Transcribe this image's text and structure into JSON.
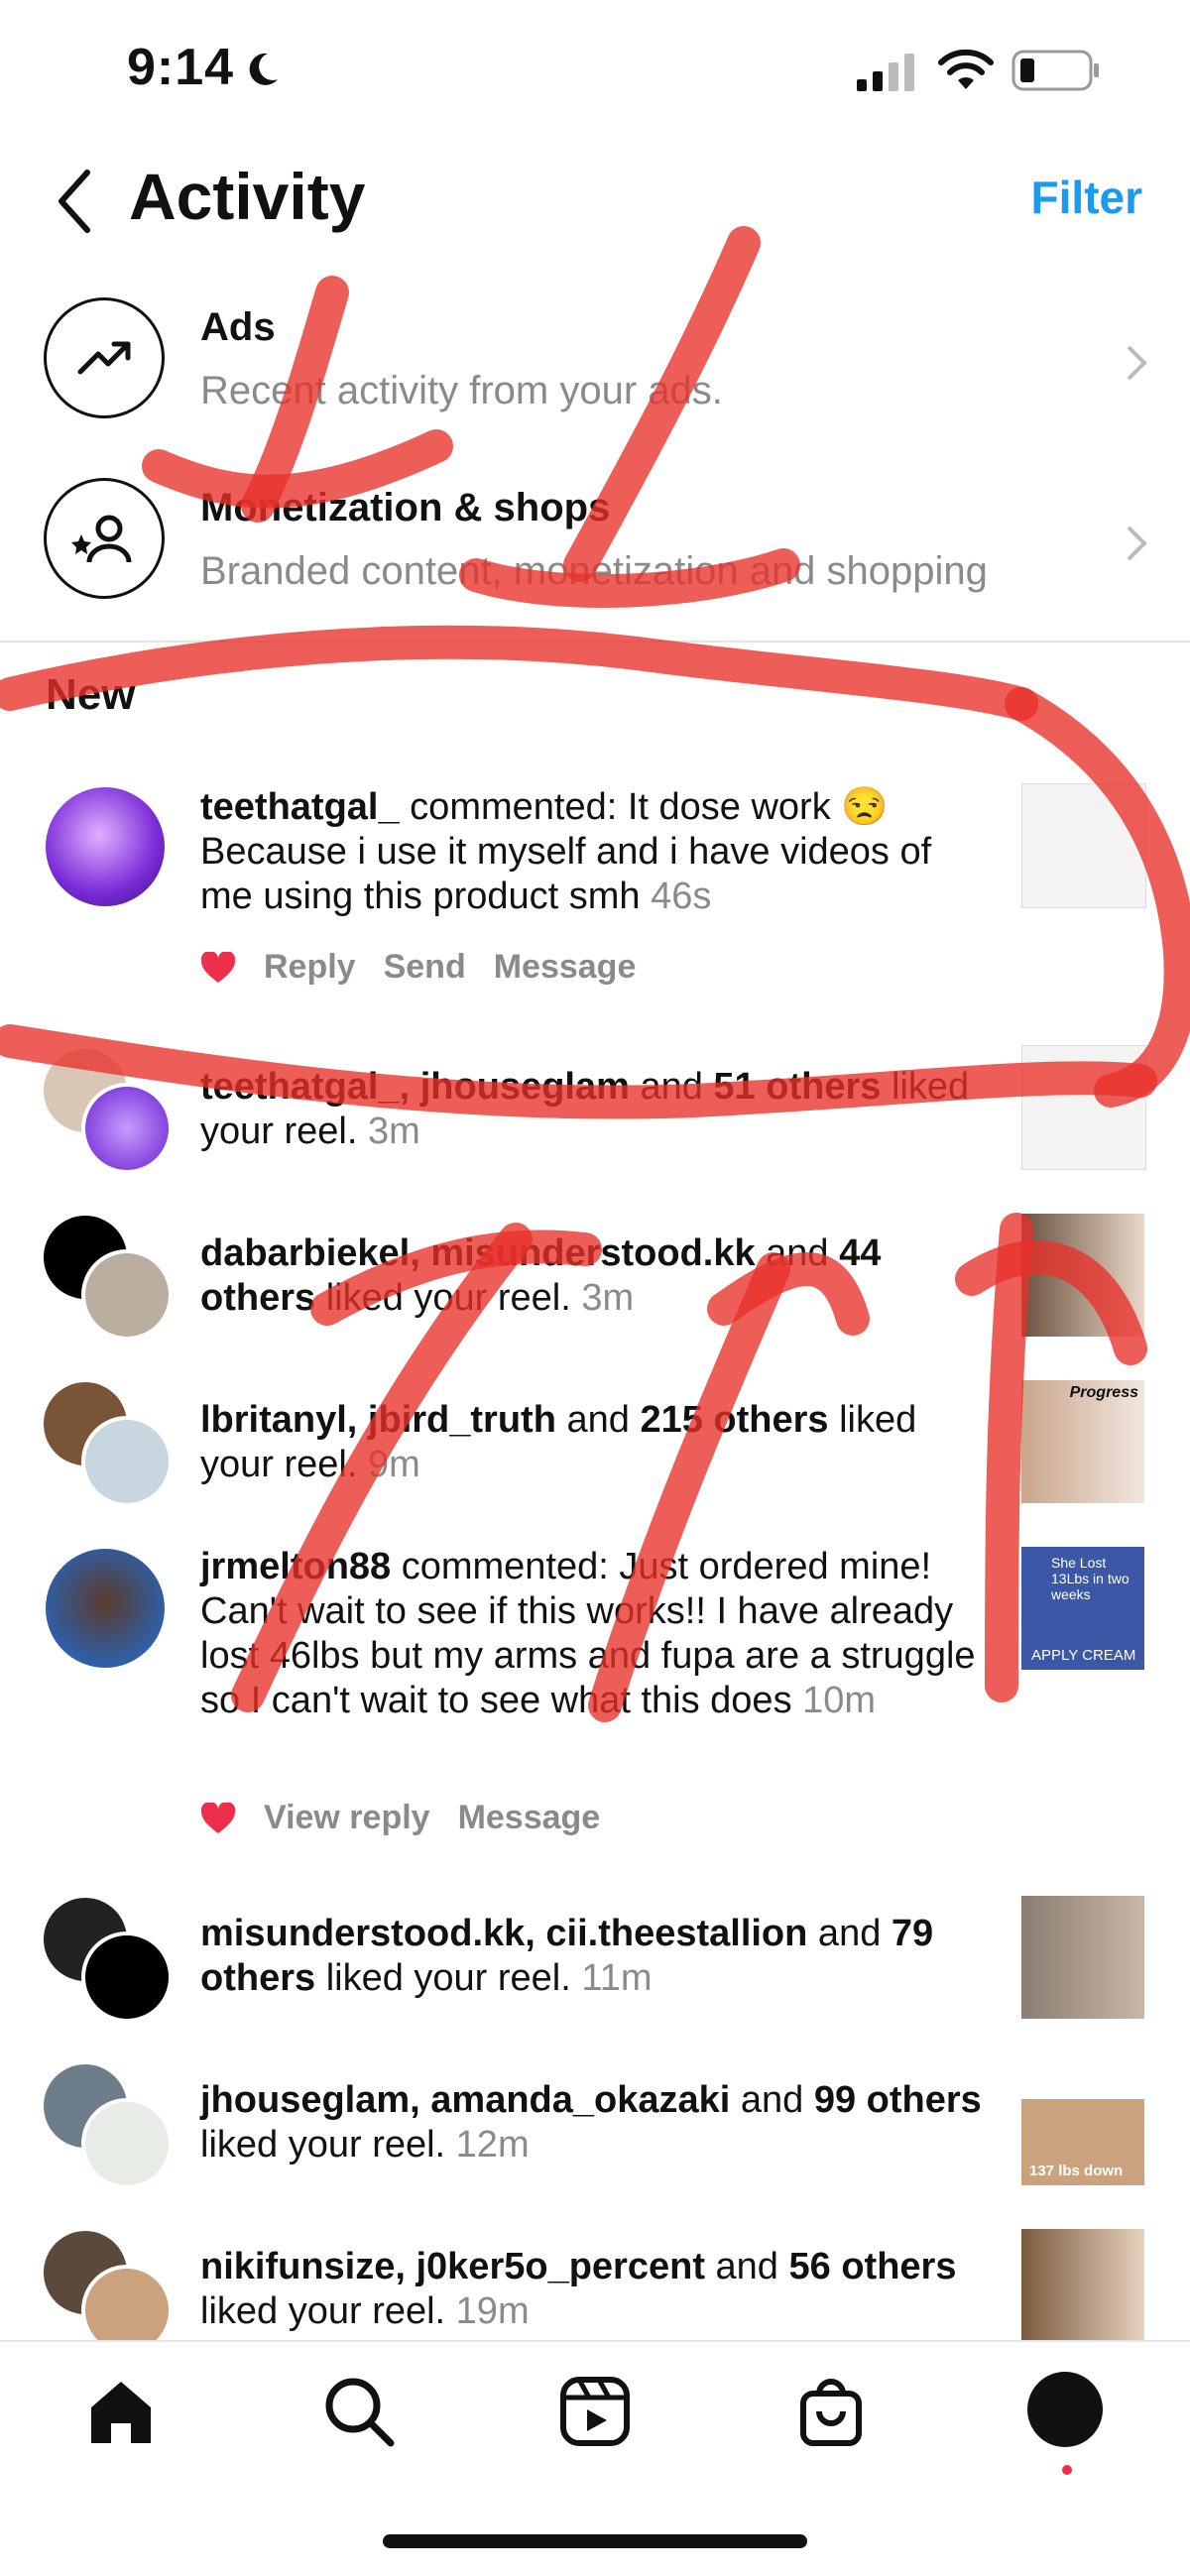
{
  "status": {
    "time": "9:14"
  },
  "header": {
    "title": "Activity",
    "filter_label": "Filter"
  },
  "menu": [
    {
      "title": "Ads",
      "subtitle": "Recent activity from your ads."
    },
    {
      "title": "Monetization & shops",
      "subtitle": "Branded content, monetization and shopping"
    }
  ],
  "section": {
    "new_label": "New"
  },
  "notifications": [
    {
      "user": "teethatgal_",
      "text": " commented: It dose work 😒 Because i use it myself and i have videos of me using this product smh ",
      "time": "46s",
      "actions": [
        "Reply",
        "Send",
        "Message"
      ]
    },
    {
      "users": "teethatgal_, jhouseglam",
      "mid": " and ",
      "others": "51 others",
      "text": " liked your reel. ",
      "time": "3m"
    },
    {
      "users": "dabarbiekel, misunderstood.kk",
      "mid": " and ",
      "others": "44 others",
      "text": " liked your reel. ",
      "time": "3m"
    },
    {
      "users": "lbritanyl, jbird_truth",
      "mid": " and ",
      "others": "215 others",
      "text": " liked your reel. ",
      "time": "9m"
    },
    {
      "user": "jrmelton88",
      "text": " commented: Just ordered mine! Can't wait to see if this works!! I have already lost 46lbs but my arms and fupa are a struggle so I can't wait to see what this does ",
      "time": "10m",
      "actions": [
        "View reply",
        "Message"
      ]
    },
    {
      "users": "misunderstood.kk, cii.theestallion",
      "mid": " and ",
      "others": "79 others",
      "text": " liked your reel. ",
      "time": "11m"
    },
    {
      "users": "jhouseglam, amanda_okazaki",
      "mid": " and ",
      "others": "99 others",
      "text": " liked your reel. ",
      "time": "12m"
    },
    {
      "users": "nikifunsize, j0ker5o_percent",
      "mid": " and ",
      "others": "56 others",
      "text": " liked your reel. ",
      "time": "19m"
    }
  ],
  "thumb_captions": {
    "t3": "Progress",
    "t4": "She Lost 13Lbs in two weeks",
    "t4b": "APPLY CREAM",
    "t6": "137 lbs down"
  },
  "icons": [
    "back-chevron-icon",
    "trending-icon",
    "add-person-icon",
    "chevron-right-icon",
    "heart-icon",
    "home-icon",
    "search-icon",
    "reels-icon",
    "shop-icon",
    "profile-icon"
  ],
  "colors": {
    "accent": "#1a9af0",
    "heart": "#ed2f4b",
    "annotation": "#e8312a"
  }
}
